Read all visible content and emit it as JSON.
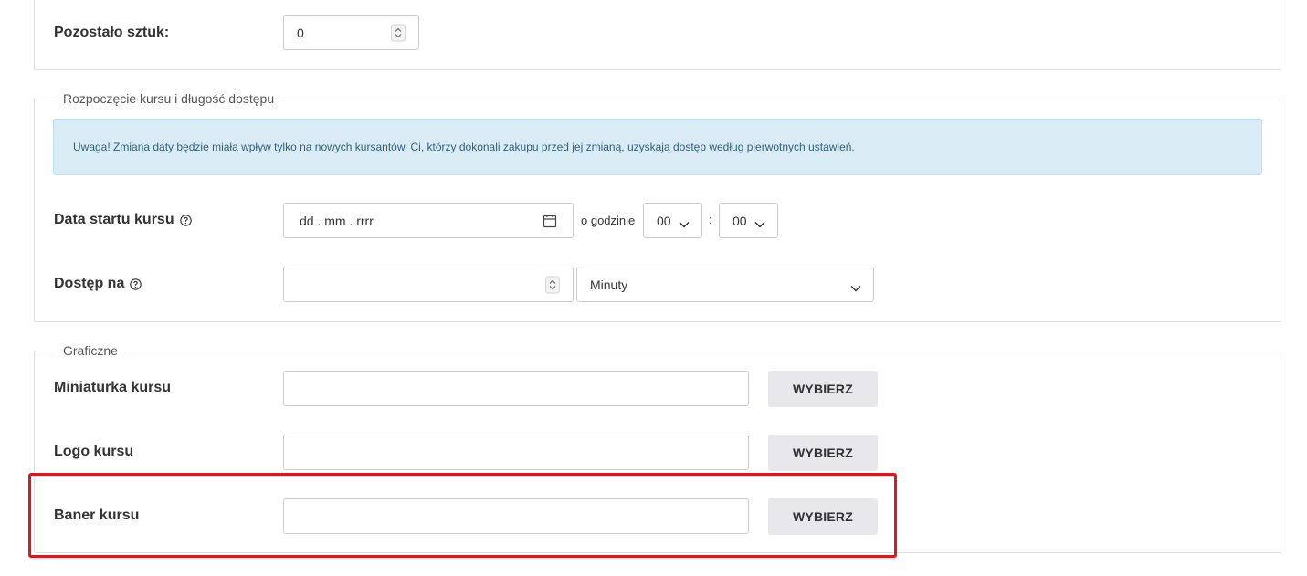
{
  "remaining": {
    "label": "Pozostało sztuk:",
    "value": "0"
  },
  "course_start": {
    "legend": "Rozpoczęcie kursu i długość dostępu",
    "alert": "Uwaga! Zmiana daty będzie miała wpływ tylko na nowych kursantów. Ci, którzy dokonali zakupu przed jej zmianą, uzyskają dostęp według pierwotnych ustawień.",
    "start_date": {
      "label": "Data startu kursu",
      "placeholder": "dd . mm . rrrr",
      "at_hour_label": "o godzinie",
      "hour_value": "00",
      "separator": ":",
      "minute_value": "00"
    },
    "access": {
      "label": "Dostęp na",
      "value": "",
      "unit_value": "Minuty"
    }
  },
  "graphics": {
    "legend": "Graficzne",
    "rows": [
      {
        "label": "Miniaturka kursu",
        "button": "WYBIERZ",
        "value": ""
      },
      {
        "label": "Logo kursu",
        "button": "WYBIERZ",
        "value": ""
      },
      {
        "label": "Baner kursu",
        "button": "WYBIERZ",
        "value": ""
      }
    ]
  },
  "colors": {
    "highlight": "#e0161b",
    "alert_bg": "#d9ecf6",
    "button_bg": "#e8e8ec"
  }
}
